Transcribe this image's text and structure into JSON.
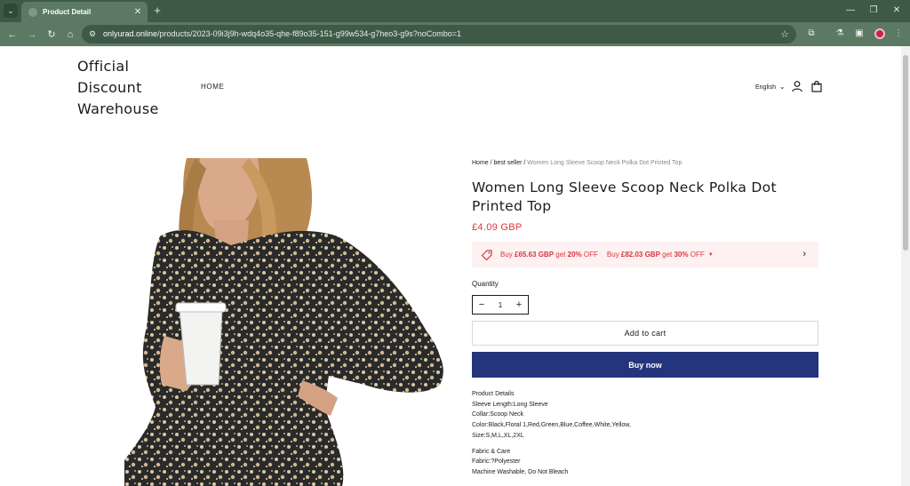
{
  "browser": {
    "tab_title": "Product Detail",
    "tab_close": "✕",
    "new_tab": "+",
    "url_host": "onlyurad.online",
    "url_path": "/products/2023-09i3j9h-wdq4o35-qhe-f89o35-151-g99w534-g7heo3-g9s?noCombo=1",
    "icons": [
      "back-icon",
      "forward-icon",
      "reload-icon",
      "home-icon",
      "site-info-icon",
      "bookmark-star-icon",
      "extensions-icon",
      "labs-icon",
      "side-panel-icon",
      "profile-icon",
      "menu-icon"
    ],
    "colors": {
      "frame": "#3e5a46",
      "toolbar": "#5c7a63",
      "profile": "#c4264a"
    }
  },
  "store": {
    "logo_lines": [
      "Official",
      "Discount",
      "Warehouse"
    ],
    "nav_home": "HOME",
    "language": "English"
  },
  "breadcrumb": {
    "home": "Home",
    "sep1": " / ",
    "category": "best seller",
    "sep2": " / ",
    "current": "Women Long Sleeve Scoop Neck Polka Dot Printed Top"
  },
  "product": {
    "title": "Women Long Sleeve Scoop Neck Polka Dot Printed Top",
    "price": "£4.09 GBP",
    "promo": {
      "t1_pre": "Buy ",
      "t1_amount": "£65.63 GBP",
      "t1_mid": " get ",
      "t1_pct": "20%",
      "t1_post": " OFF",
      "t2_pre": "Buy ",
      "t2_amount": "£82.03 GBP",
      "t2_mid": " get ",
      "t2_pct": "30%",
      "t2_post": " OFF"
    },
    "quantity_label": "Quantity",
    "quantity_value": "1",
    "minus": "−",
    "plus": "+",
    "add_to_cart": "Add to cart",
    "buy_now": "Buy now",
    "details": [
      "Product Details",
      "Sleeve Length:Long Sleeve",
      "Collar:Scoop Neck",
      "Color:Black,Floral 1,Red,Green,Blue,Coffee,White,Yellow,",
      "Size:S,M,L,XL,2XL"
    ],
    "care": [
      "Fabric & Care",
      "Fabric:?Polyester",
      "Machine Washable, Do Not Bleach"
    ],
    "colors": {
      "price": "#d9363e",
      "promo_bg": "#fdf1f1",
      "buy_now": "#24357d"
    }
  }
}
